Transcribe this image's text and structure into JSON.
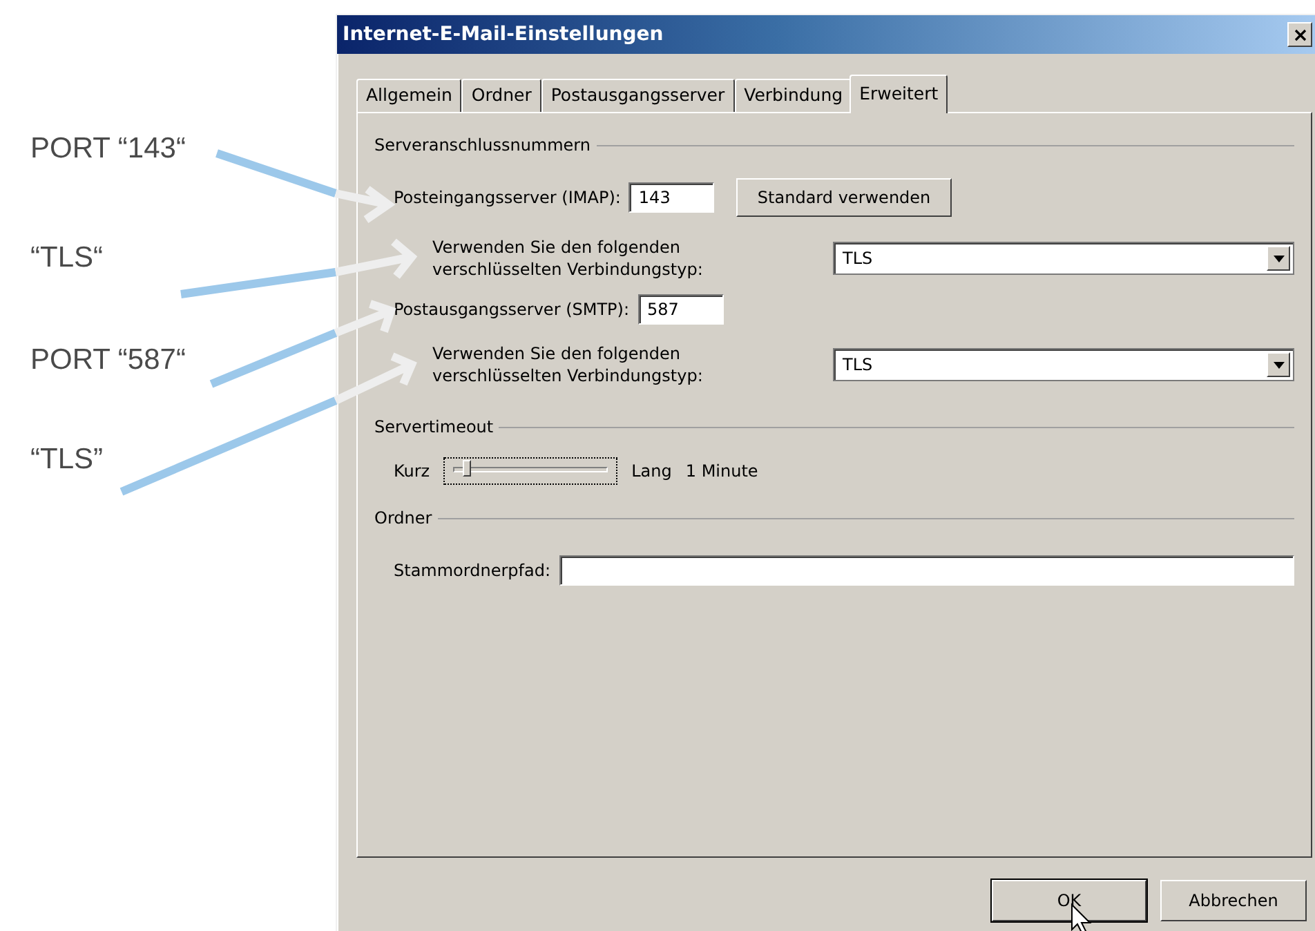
{
  "annotations": [
    {
      "text": "PORT “143“"
    },
    {
      "text": "“TLS“"
    },
    {
      "text": "PORT “587“"
    },
    {
      "text": "“TLS”"
    }
  ],
  "window": {
    "title": "Internet-E-Mail-Einstellungen"
  },
  "tabs": [
    {
      "label": "Allgemein",
      "selected": false
    },
    {
      "label": "Ordner",
      "selected": false
    },
    {
      "label": "Postausgangsserver",
      "selected": false
    },
    {
      "label": "Verbindung",
      "selected": false
    },
    {
      "label": "Erweitert",
      "selected": true
    }
  ],
  "server_ports": {
    "title": "Serveranschlussnummern",
    "incoming": {
      "label": "Posteingangsserver (IMAP):",
      "value": "143"
    },
    "default_button": "Standard verwenden",
    "incoming_encryption": {
      "label_lines": [
        "Verwenden Sie den folgenden",
        "verschlüsselten Verbindungstyp:"
      ],
      "value": "TLS"
    },
    "outgoing": {
      "label": "Postausgangsserver (SMTP):",
      "value": "587"
    },
    "outgoing_encryption": {
      "label_lines": [
        "Verwenden Sie den folgenden",
        "verschlüsselten Verbindungstyp:"
      ],
      "value": "TLS"
    }
  },
  "timeout": {
    "title": "Servertimeout",
    "min_label": "Kurz",
    "max_label": "Lang",
    "level": 0.08,
    "reading": "1 Minute"
  },
  "folder": {
    "title": "Ordner",
    "root_label": "Stammordnerpfad:"
  },
  "buttons": [
    {
      "label": "OK",
      "default": true
    },
    {
      "label": "Abbrechen",
      "default": false
    }
  ]
}
